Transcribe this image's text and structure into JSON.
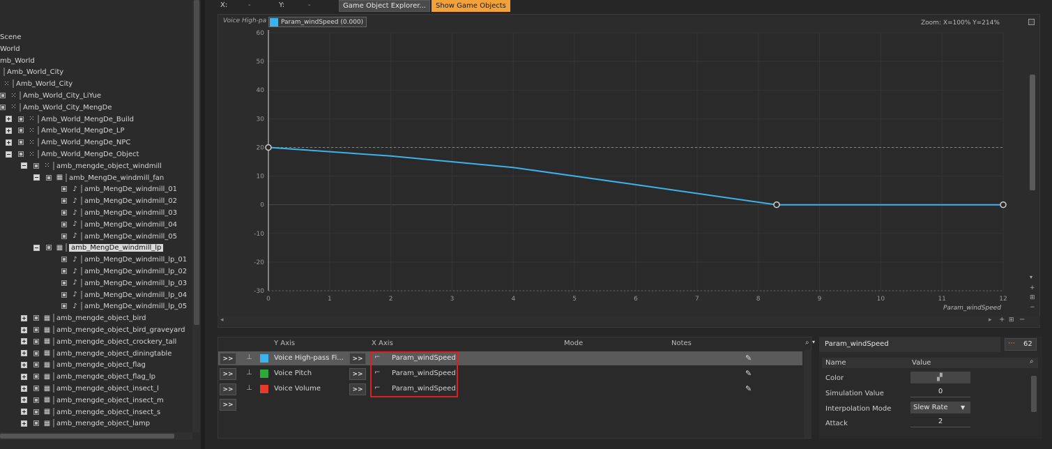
{
  "tree": {
    "items": [
      {
        "label": "Scene",
        "indent": 0,
        "exp": "",
        "chk": false,
        "icon": ""
      },
      {
        "label": "World",
        "indent": 0,
        "exp": "",
        "chk": false,
        "icon": ""
      },
      {
        "label": "mb_World",
        "indent": 0,
        "exp": "",
        "chk": false,
        "icon": ""
      },
      {
        "label": "Amb_World_City",
        "indent": 1,
        "exp": "",
        "chk": false,
        "icon": "bar"
      },
      {
        "label": "Amb_World_City",
        "indent": 2,
        "exp": "",
        "chk": false,
        "icon": "dots"
      },
      {
        "label": "Amb_World_City_LiYue",
        "indent": 3,
        "exp": "",
        "chk": true,
        "icon": "dots"
      },
      {
        "label": "Amb_World_City_MengDe",
        "indent": 3,
        "exp": "",
        "chk": true,
        "icon": "dots"
      },
      {
        "label": "Amb_World_MengDe_Build",
        "indent": 4,
        "exp": "plus",
        "chk": true,
        "icon": "dots"
      },
      {
        "label": "Amb_World_MengDe_LP",
        "indent": 4,
        "exp": "plus",
        "chk": true,
        "icon": "dots"
      },
      {
        "label": "Amb_World_MengDe_NPC",
        "indent": 4,
        "exp": "plus",
        "chk": true,
        "icon": "dots"
      },
      {
        "label": "Amb_World_MengDe_Object",
        "indent": 4,
        "exp": "minus",
        "chk": true,
        "icon": "dots"
      },
      {
        "label": "amb_mengde_object_windmill",
        "indent": 5,
        "exp": "minus",
        "chk": true,
        "icon": "dots"
      },
      {
        "label": "amb_MengDe_windmill_fan",
        "indent": 6,
        "exp": "minus",
        "chk": true,
        "icon": "grid"
      },
      {
        "label": "amb_MengDe_windmill_01",
        "indent": 7,
        "exp": "",
        "chk": true,
        "icon": "snd"
      },
      {
        "label": "amb_MengDe_windmill_02",
        "indent": 7,
        "exp": "",
        "chk": true,
        "icon": "snd"
      },
      {
        "label": "amb_MengDe_windmill_03",
        "indent": 7,
        "exp": "",
        "chk": true,
        "icon": "snd"
      },
      {
        "label": "amb_MengDe_windmill_04",
        "indent": 7,
        "exp": "",
        "chk": true,
        "icon": "snd"
      },
      {
        "label": "amb_MengDe_windmill_05",
        "indent": 7,
        "exp": "",
        "chk": true,
        "icon": "snd"
      },
      {
        "label": "amb_MengDe_windmill_lp",
        "indent": 6,
        "exp": "minus",
        "chk": true,
        "icon": "grid",
        "selected": true
      },
      {
        "label": "amb_MengDe_windmill_lp_01",
        "indent": 7,
        "exp": "",
        "chk": true,
        "icon": "snd"
      },
      {
        "label": "amb_MengDe_windmill_lp_02",
        "indent": 7,
        "exp": "",
        "chk": true,
        "icon": "snd"
      },
      {
        "label": "amb_MengDe_windmill_lp_03",
        "indent": 7,
        "exp": "",
        "chk": true,
        "icon": "snd"
      },
      {
        "label": "amb_MengDe_windmill_lp_04",
        "indent": 7,
        "exp": "",
        "chk": true,
        "icon": "snd"
      },
      {
        "label": "amb_MengDe_windmill_lp_05",
        "indent": 7,
        "exp": "",
        "chk": true,
        "icon": "snd"
      },
      {
        "label": "amb_mengde_object_bird",
        "indent": 5,
        "exp": "plus",
        "chk": true,
        "icon": "grid"
      },
      {
        "label": "amb_mengde_object_bird_graveyard",
        "indent": 5,
        "exp": "plus",
        "chk": true,
        "icon": "grid"
      },
      {
        "label": "amb_mengde_object_crockery_tall",
        "indent": 5,
        "exp": "plus",
        "chk": true,
        "icon": "grid"
      },
      {
        "label": "amb_mengde_object_diningtable",
        "indent": 5,
        "exp": "plus",
        "chk": true,
        "icon": "grid"
      },
      {
        "label": "amb_mengde_object_flag",
        "indent": 5,
        "exp": "plus",
        "chk": true,
        "icon": "grid"
      },
      {
        "label": "amb_mengde_object_flag_lp",
        "indent": 5,
        "exp": "plus",
        "chk": true,
        "icon": "grid"
      },
      {
        "label": "amb_mengde_object_insect_l",
        "indent": 5,
        "exp": "plus",
        "chk": true,
        "icon": "grid"
      },
      {
        "label": "amb_mengde_object_insect_m",
        "indent": 5,
        "exp": "plus",
        "chk": true,
        "icon": "grid"
      },
      {
        "label": "amb_mengde_object_insect_s",
        "indent": 5,
        "exp": "plus",
        "chk": true,
        "icon": "grid"
      },
      {
        "label": "amb_mengde_object_lamp",
        "indent": 5,
        "exp": "plus",
        "chk": true,
        "icon": "grid"
      }
    ]
  },
  "toolbar": {
    "x_label": "X:",
    "x_value": "-",
    "y_label": "Y:",
    "y_value": "-",
    "game_object_explorer": "Game Object Explorer...",
    "show_game_objects": "Show Game Objects"
  },
  "graph": {
    "y_title": "Voice High-pa",
    "param_tag": "Param_windSpeed (0.000)",
    "zoom": "Zoom: X=100% Y=214%",
    "x_title": "Param_windSpeed",
    "curve_color": "#3db3ee"
  },
  "chart_data": {
    "type": "line",
    "xlabel": "Param_windSpeed",
    "ylabel": "Voice High-pa",
    "xlim": [
      0,
      12
    ],
    "ylim": [
      -30,
      60
    ],
    "x_ticks": [
      "0",
      "1",
      "2",
      "3",
      "4",
      "5",
      "6",
      "7",
      "8",
      "9",
      "10",
      "11",
      "12"
    ],
    "y_ticks": [
      "60",
      "50",
      "40",
      "30",
      "20",
      "10",
      "0",
      "-10",
      "-20",
      "-30"
    ],
    "series": [
      {
        "x": [
          0,
          2,
          4,
          6,
          8.3,
          12
        ],
        "y": [
          20,
          17,
          13,
          7,
          0,
          0
        ]
      }
    ],
    "points": [
      {
        "x": 0,
        "y": 20
      },
      {
        "x": 8.3,
        "y": 0
      },
      {
        "x": 12,
        "y": 0
      }
    ],
    "reference_line_y": 20
  },
  "rtpc": {
    "headers": {
      "y_axis": "Y Axis",
      "x_axis": "X Axis",
      "mode": "Mode",
      "notes": "Notes"
    },
    "btn": ">>",
    "rows": [
      {
        "y_axis": "Voice High-pass Fi...",
        "x_axis": "Param_windSpeed",
        "color": "#3db3ee",
        "selected": true
      },
      {
        "y_axis": "Voice Pitch",
        "x_axis": "Param_windSpeed",
        "color": "#2fa83a",
        "selected": false
      },
      {
        "y_axis": "Voice Volume",
        "x_axis": "Param_windSpeed",
        "color": "#e53b2c",
        "selected": false
      }
    ]
  },
  "props": {
    "title": "Param_windSpeed",
    "count": "62",
    "col_name": "Name",
    "col_value": "Value",
    "color_label": "Color",
    "sim_label": "Simulation Value",
    "sim_value": "0",
    "interp_label": "Interpolation Mode",
    "interp_value": "Slew Rate",
    "attack_label": "Attack",
    "attack_value": "2"
  }
}
